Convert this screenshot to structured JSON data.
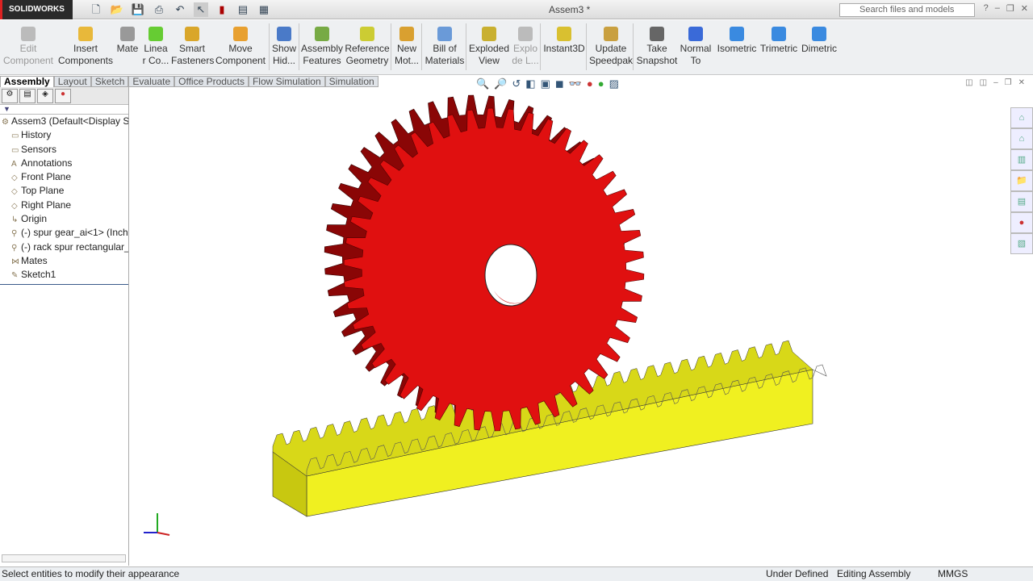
{
  "app": {
    "brand": "SOLIDWORKS",
    "title": "Assem3 *",
    "search_placeholder": "Search files and models"
  },
  "ribbon": [
    {
      "label": "Edit Component",
      "disabled": true
    },
    {
      "label": "Insert Components"
    },
    {
      "label": "Mate"
    },
    {
      "label": "Linea r Co..."
    },
    {
      "label": "Smart Fasteners"
    },
    {
      "label": "Move Component"
    },
    {
      "label": "Show Hid..."
    },
    {
      "label": "Assembly Features"
    },
    {
      "label": "Reference Geometry"
    },
    {
      "label": "New Mot..."
    },
    {
      "label": "Bill of Materials"
    },
    {
      "label": "Exploded View"
    },
    {
      "label": "Explo de L...",
      "disabled": true
    },
    {
      "label": "Instant3D"
    },
    {
      "label": "Update Speedpak"
    },
    {
      "label": "Take Snapshot"
    },
    {
      "label": "Normal To"
    },
    {
      "label": "Isometric"
    },
    {
      "label": "Trimetric"
    },
    {
      "label": "Dimetric"
    }
  ],
  "tabs": [
    "Assembly",
    "Layout",
    "Sketch",
    "Evaluate",
    "Office Products",
    "Flow Simulation",
    "Simulation"
  ],
  "tree": [
    {
      "label": "Assem3  (Default<Display State",
      "icon": "assembly-icon"
    },
    {
      "label": "History",
      "icon": "folder-icon"
    },
    {
      "label": "Sensors",
      "icon": "folder-icon"
    },
    {
      "label": "Annotations",
      "icon": "annotation-icon"
    },
    {
      "label": "Front Plane",
      "icon": "plane-icon"
    },
    {
      "label": "Top Plane",
      "icon": "plane-icon"
    },
    {
      "label": "Right Plane",
      "icon": "plane-icon"
    },
    {
      "label": "Origin",
      "icon": "origin-icon"
    },
    {
      "label": "(-) spur gear_ai<1> (Inch",
      "icon": "part-icon"
    },
    {
      "label": "(-) rack spur rectangular_",
      "icon": "part-icon"
    },
    {
      "label": "Mates",
      "icon": "mates-icon"
    },
    {
      "label": "Sketch1",
      "icon": "sketch-icon"
    }
  ],
  "status": {
    "message": "Select entities to modify their appearance",
    "definition": "Under Defined",
    "mode": "Editing Assembly",
    "units": "MMGS"
  },
  "colors": {
    "gear": "#e01010",
    "rack": "#f0f020",
    "accent": "#d22"
  }
}
